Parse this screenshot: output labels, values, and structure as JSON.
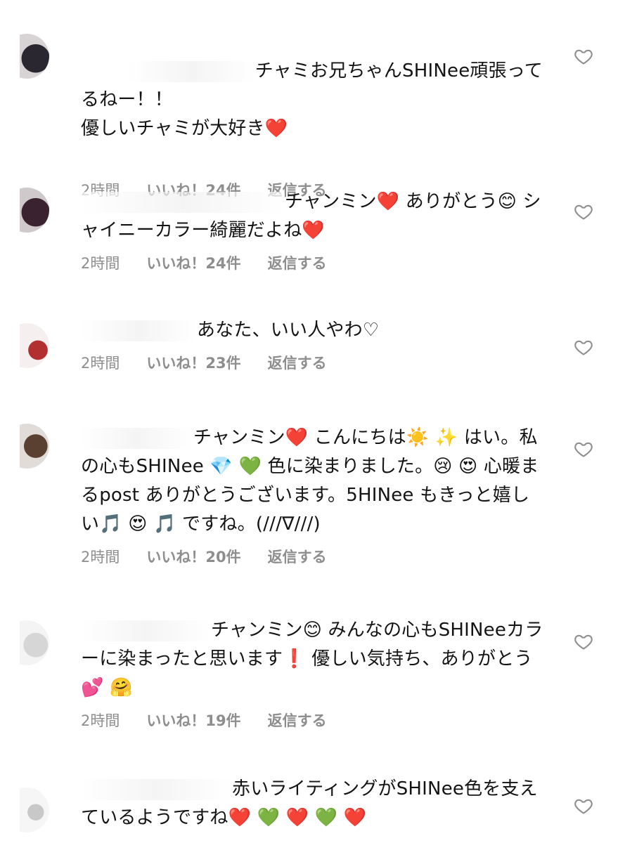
{
  "comments": [
    {
      "text": "チャミお兄ちゃんSHINee頑張ってるねー！！\n優しいチャミが大好き❤️",
      "time": "2時間",
      "likes": "いいね！24件",
      "reply": "返信する"
    },
    {
      "text": "チャンミン❤️ ありがとう😊 シャイニーカラー綺麗だよね❤️",
      "time": "2時間",
      "likes": "いいね！24件",
      "reply": "返信する"
    },
    {
      "text": "あなた、いい人やわ♡",
      "time": "2時間",
      "likes": "いいね！23件",
      "reply": "返信する"
    },
    {
      "text": "チャンミン❤️ こんにちは☀️ ✨ はい。私の心もSHINee 💎 💚 色に染まりました。😢 😍 心暖まるpost ありがとうございます。5HINee もきっと嬉しい🎵 😍 🎵 ですね。(///∇///)",
      "time": "2時間",
      "likes": "いいね！20件",
      "reply": "返信する"
    },
    {
      "text": "チャンミン😊 みんなの心もSHINeeカラーに染まったと思います❗️ 優しい気持ち、ありがとう💕 🤗",
      "time": "2時間",
      "likes": "いいね！19件",
      "reply": "返信する"
    },
    {
      "text": "赤いライティングがSHINee色を支えているようですね❤️ 💚 ❤️ 💚 ❤️",
      "time": "",
      "likes": "",
      "reply": ""
    }
  ],
  "icons": {
    "like": "heart-outline-icon"
  },
  "colors": {
    "meta": "#8e8e8e",
    "text": "#141414",
    "heart_stroke": "#8e8e8e"
  }
}
